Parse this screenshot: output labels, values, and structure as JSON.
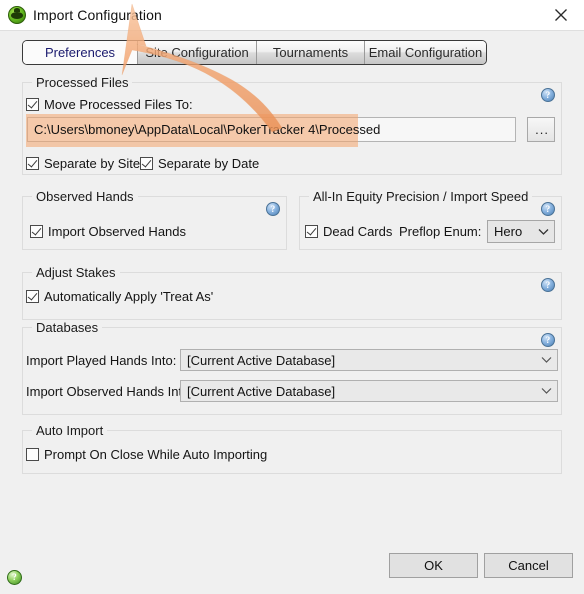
{
  "window": {
    "title": "Import Configuration",
    "icon": "pokertracker-green-icon",
    "close_label": "✕"
  },
  "tabs": [
    {
      "label": "Preferences",
      "active": true
    },
    {
      "label": "Site Configuration",
      "active": false
    },
    {
      "label": "Tournaments",
      "active": false
    },
    {
      "label": "Email Configuration",
      "active": false
    }
  ],
  "groups": {
    "processed_files": {
      "legend": "Processed Files",
      "move_checkbox": {
        "label": "Move Processed Files To:",
        "checked": true
      },
      "path_value": "C:\\Users\\bmoney\\AppData\\Local\\PokerTracker 4\\Processed",
      "browse_label": "...",
      "separate_by_site": {
        "label": "Separate by Site",
        "checked": true
      },
      "separate_by_date": {
        "label": "Separate by Date",
        "checked": true
      }
    },
    "observed_hands": {
      "legend": "Observed Hands",
      "import_observed": {
        "label": "Import Observed Hands",
        "checked": true
      }
    },
    "allin_equity": {
      "legend": "All-In Equity Precision / Import Speed",
      "dead_cards": {
        "label": "Dead Cards",
        "checked": true
      },
      "preflop_enum_label": "Preflop Enum:",
      "preflop_enum_value": "Hero"
    },
    "adjust_stakes": {
      "legend": "Adjust Stakes",
      "auto_treat_as": {
        "label": "Automatically Apply 'Treat As'",
        "checked": true
      }
    },
    "databases": {
      "legend": "Databases",
      "played_label": "Import Played Hands Into:",
      "played_value": "[Current Active Database]",
      "observed_label": "Import Observed Hands Into:",
      "observed_value": "[Current Active Database]"
    },
    "auto_import": {
      "legend": "Auto Import",
      "prompt_on_close": {
        "label": "Prompt On Close While Auto Importing",
        "checked": false
      }
    }
  },
  "footer": {
    "ok_label": "OK",
    "cancel_label": "Cancel",
    "help_glyph": "?"
  },
  "help_glyph": "?",
  "colors": {
    "window_bg": "#f0f0f0",
    "titlebar_bg": "#ffffff",
    "annotation": "#f4a46b",
    "highlight": "#f4a46b",
    "tab_text": "#12124a"
  }
}
